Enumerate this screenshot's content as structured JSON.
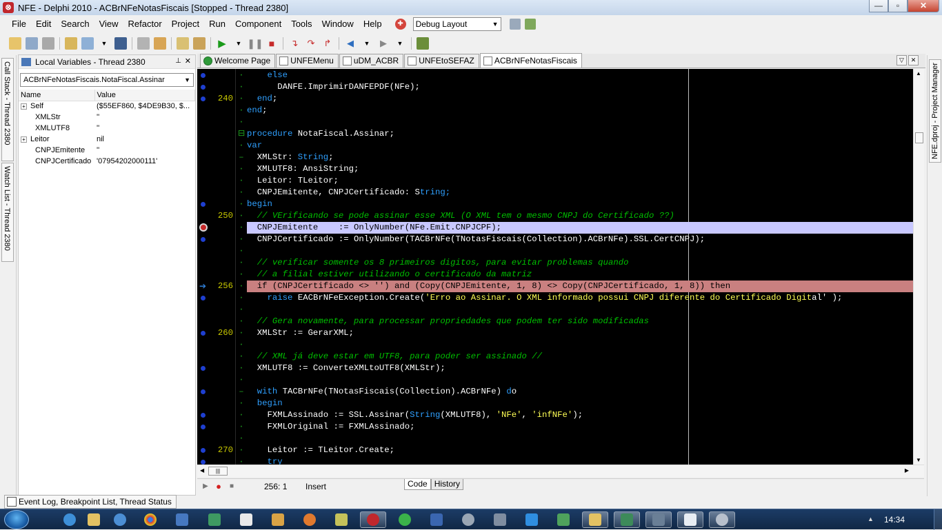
{
  "window": {
    "title": "NFE - Delphi 2010 - ACBrNFeNotasFiscais [Stopped - Thread 2380]",
    "controls": [
      "—",
      "▫",
      "✕"
    ]
  },
  "menu": {
    "items": [
      "File",
      "Edit",
      "Search",
      "View",
      "Refactor",
      "Project",
      "Run",
      "Component",
      "Tools",
      "Window",
      "Help"
    ],
    "layout_select": "Debug Layout"
  },
  "left_tabs": {
    "call_stack": "Call Stack - Thread 2380",
    "watch_list": "Watch List - Thread 2380"
  },
  "local_vars": {
    "title": "Local Variables - Thread 2380",
    "context": "ACBrNFeNotasFiscais.NotaFiscal.Assinar",
    "col_name": "Name",
    "col_value": "Value",
    "rows": [
      {
        "name": "Self",
        "value": "($55EF860, $4DE9B30, $...",
        "expand": "+"
      },
      {
        "name": "XMLStr",
        "value": "''",
        "expand": ""
      },
      {
        "name": "XMLUTF8",
        "value": "''",
        "expand": ""
      },
      {
        "name": "Leitor",
        "value": "nil",
        "expand": "+"
      },
      {
        "name": "CNPJEmitente",
        "value": "''",
        "expand": ""
      },
      {
        "name": "CNPJCertificado",
        "value": "'07954202000111'",
        "expand": ""
      }
    ]
  },
  "editor_tabs": [
    "Welcome Page",
    "UNFEMenu",
    "uDM_ACBR",
    "UNFEtoSEFAZ",
    "ACBrNFeNotasFiscais"
  ],
  "editor_active_tab": 4,
  "code": [
    {
      "ln": "",
      "m": "dot",
      "f": "·",
      "t": "    else",
      "k": [
        [
          4,
          8,
          "kw"
        ]
      ]
    },
    {
      "ln": "",
      "m": "dot",
      "f": "·",
      "t": "      DANFE.ImprimirDANFEPDF(NFe);",
      "k": []
    },
    {
      "ln": "240",
      "m": "dot",
      "f": "·",
      "t": "  end;",
      "k": [
        [
          2,
          5,
          "kw"
        ]
      ]
    },
    {
      "ln": "",
      "m": "",
      "f": "·",
      "t": "end;",
      "k": [
        [
          0,
          3,
          "kw"
        ]
      ]
    },
    {
      "ln": "",
      "m": "",
      "f": "·",
      "t": "",
      "k": []
    },
    {
      "ln": "",
      "m": "",
      "f": "⊟",
      "t": "procedure NotaFiscal.Assinar;",
      "k": [
        [
          0,
          9,
          "kw"
        ]
      ]
    },
    {
      "ln": "",
      "m": "",
      "f": "·",
      "t": "var",
      "k": [
        [
          0,
          3,
          "kw"
        ]
      ]
    },
    {
      "ln": "",
      "m": "",
      "f": "–",
      "t": "  XMLStr: String;",
      "k": [
        [
          10,
          16,
          "kw"
        ]
      ]
    },
    {
      "ln": "",
      "m": "",
      "f": "·",
      "t": "  XMLUTF8: AnsiString;",
      "k": []
    },
    {
      "ln": "",
      "m": "",
      "f": "·",
      "t": "  Leitor: TLeitor;",
      "k": []
    },
    {
      "ln": "",
      "m": "",
      "f": "·",
      "t": "  CNPJEmitente, CNPJCertificado: String;",
      "k": [
        [
          34,
          40,
          "kw"
        ]
      ]
    },
    {
      "ln": "",
      "m": "dot",
      "f": "·",
      "t": "begin",
      "k": [
        [
          0,
          5,
          "kw"
        ]
      ]
    },
    {
      "ln": "250",
      "m": "",
      "f": "·",
      "t": "  // VErificando se pode assinar esse XML (O XML tem o mesmo CNPJ do Certificado ??)",
      "k": [
        [
          2,
          86,
          "cm"
        ]
      ]
    },
    {
      "ln": "",
      "m": "bp",
      "f": "·",
      "t": "  CNPJEmitente    := OnlyNumber(NFe.Emit.CNPJCPF);",
      "k": [],
      "hl": "exec"
    },
    {
      "ln": "",
      "m": "dot",
      "f": "·",
      "t": "  CNPJCertificado := OnlyNumber(TACBrNFe(TNotasFiscais(Collection).ACBrNFe).SSL.CertCNPJ);",
      "k": []
    },
    {
      "ln": "",
      "m": "",
      "f": "·",
      "t": "",
      "k": []
    },
    {
      "ln": "",
      "m": "",
      "f": "·",
      "t": "  // verificar somente os 8 primeiros digitos, para evitar problemas quando",
      "k": [
        [
          2,
          76,
          "cm"
        ]
      ]
    },
    {
      "ln": "",
      "m": "",
      "f": "·",
      "t": "  // a filial estiver utilizando o certificado da matriz",
      "k": [
        [
          2,
          56,
          "cm"
        ]
      ]
    },
    {
      "ln": "256",
      "m": "arrow",
      "f": "·",
      "t": "  if (CNPJCertificado <> '') and (Copy(CNPJEmitente, 1, 8) <> Copy(CNPJCertificado, 1, 8)) then",
      "k": [
        [
          2,
          4,
          "kw"
        ],
        [
          24,
          26,
          "st"
        ],
        [
          28,
          31,
          "kw"
        ],
        [
          92,
          96,
          "kw"
        ]
      ],
      "hl": "bp"
    },
    {
      "ln": "",
      "m": "dot",
      "f": "·",
      "t": "    raise EACBrNFeException.Create('Erro ao Assinar. O XML informado possui CNPJ diferente do Certificado Digital' );",
      "k": [
        [
          4,
          9,
          "kw"
        ],
        [
          35,
          111,
          "st"
        ]
      ]
    },
    {
      "ln": "",
      "m": "",
      "f": "·",
      "t": "",
      "k": []
    },
    {
      "ln": "",
      "m": "",
      "f": "·",
      "t": "  // Gera novamente, para processar propriedades que podem ter sido modificadas",
      "k": [
        [
          2,
          79,
          "cm"
        ]
      ]
    },
    {
      "ln": "260",
      "m": "dot",
      "f": "·",
      "t": "  XMLStr := GerarXML;",
      "k": []
    },
    {
      "ln": "",
      "m": "",
      "f": "·",
      "t": "",
      "k": []
    },
    {
      "ln": "",
      "m": "",
      "f": "·",
      "t": "  // XML já deve estar em UTF8, para poder ser assinado //",
      "k": [
        [
          2,
          58,
          "cm"
        ]
      ]
    },
    {
      "ln": "",
      "m": "dot",
      "f": "·",
      "t": "  XMLUTF8 := ConverteXMLtoUTF8(XMLStr);",
      "k": []
    },
    {
      "ln": "",
      "m": "",
      "f": "·",
      "t": "",
      "k": []
    },
    {
      "ln": "",
      "m": "dot",
      "f": "–",
      "t": "  with TACBrNFe(TNotasFiscais(Collection).ACBrNFe) do",
      "k": [
        [
          2,
          6,
          "kw"
        ],
        [
          50,
          52,
          "kw"
        ]
      ]
    },
    {
      "ln": "",
      "m": "",
      "f": "·",
      "t": "  begin",
      "k": [
        [
          2,
          7,
          "kw"
        ]
      ]
    },
    {
      "ln": "",
      "m": "dot",
      "f": "·",
      "t": "    FXMLAssinado := SSL.Assinar(String(XMLUTF8), 'NFe', 'infNFe');",
      "k": [
        [
          32,
          38,
          "kw"
        ],
        [
          49,
          54,
          "st"
        ],
        [
          56,
          64,
          "st"
        ]
      ]
    },
    {
      "ln": "",
      "m": "dot",
      "f": "·",
      "t": "    FXMLOriginal := FXMLAssinado;",
      "k": []
    },
    {
      "ln": "",
      "m": "",
      "f": "·",
      "t": "",
      "k": []
    },
    {
      "ln": "270",
      "m": "dot",
      "f": "·",
      "t": "    Leitor := TLeitor.Create;",
      "k": []
    },
    {
      "ln": "",
      "m": "dot",
      "f": "·",
      "t": "    try",
      "k": [
        [
          4,
          7,
          "kw"
        ]
      ]
    }
  ],
  "status": {
    "position": "256:  1",
    "mode": "Insert",
    "code_tab": "Code",
    "history_tab": "History"
  },
  "right_tab": "NFE.dproj - Project Manager",
  "bottom_tab": "Event Log, Breakpoint List, Thread Status",
  "taskbar": {
    "clock": "14:34"
  }
}
